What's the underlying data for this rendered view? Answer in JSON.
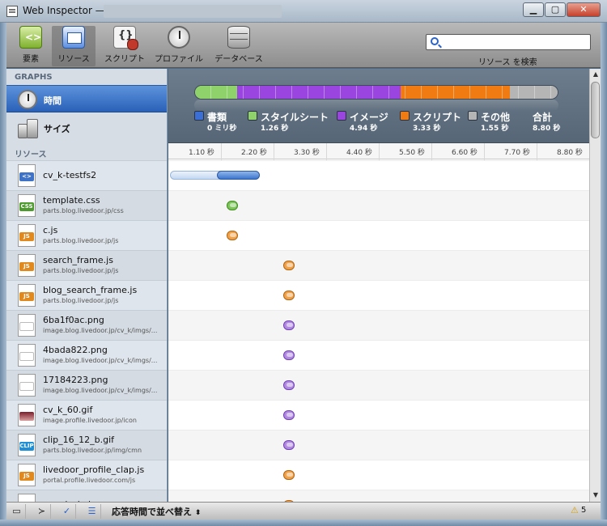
{
  "window": {
    "title": "Web Inspector —"
  },
  "toolbar": {
    "elements_label": "要素",
    "resources_label": "リソース",
    "scripts_label": "スクリプト",
    "profiles_label": "プロファイル",
    "databases_label": "データベース",
    "search_placeholder": "",
    "search_label": "リソース を検索"
  },
  "sidebar": {
    "graphs_title": "GRAPHS",
    "graphs": [
      {
        "label": "時間",
        "icon": "clock-icon",
        "selected": true
      },
      {
        "label": "サイズ",
        "icon": "weights-icon",
        "selected": false
      }
    ],
    "resources_title": "リソース",
    "resources": [
      {
        "name": "cv_k-testfs2",
        "url": "",
        "kind": "html"
      },
      {
        "name": "template.css",
        "url": "parts.blog.livedoor.jp/css",
        "kind": "css"
      },
      {
        "name": "c.js",
        "url": "parts.blog.livedoor.jp/js",
        "kind": "js"
      },
      {
        "name": "search_frame.js",
        "url": "parts.blog.livedoor.jp/js",
        "kind": "js"
      },
      {
        "name": "blog_search_frame.js",
        "url": "parts.blog.livedoor.jp/js",
        "kind": "js"
      },
      {
        "name": "6ba1f0ac.png",
        "url": "image.blog.livedoor.jp/cv_k/imgs/...",
        "kind": "img"
      },
      {
        "name": "4bada822.png",
        "url": "image.blog.livedoor.jp/cv_k/imgs/...",
        "kind": "img"
      },
      {
        "name": "17184223.png",
        "url": "image.blog.livedoor.jp/cv_k/imgs/...",
        "kind": "img"
      },
      {
        "name": "cv_k_60.gif",
        "url": "image.profile.livedoor.jp/icon",
        "kind": "gif-avatar"
      },
      {
        "name": "clip_16_12_b.gif",
        "url": "parts.blog.livedoor.jp/img/cmn",
        "kind": "clip"
      },
      {
        "name": "livedoor_profile_clap.js",
        "url": "portal.profile.livedoor.com/js",
        "kind": "js"
      },
      {
        "name": "google_ja.js",
        "url": "",
        "kind": "js"
      }
    ]
  },
  "summary": {
    "legend": [
      {
        "label": "書類",
        "value": "0 ミリ秒",
        "color": "#3b6fd6"
      },
      {
        "label": "スタイルシート",
        "value": "1.26 秒",
        "color": "#8fd16a"
      },
      {
        "label": "イメージ",
        "value": "4.94 秒",
        "color": "#9b45e0"
      },
      {
        "label": "スクリプト",
        "value": "3.33 秒",
        "color": "#f07b12"
      },
      {
        "label": "その他",
        "value": "1.55 秒",
        "color": "#b5b5b5"
      }
    ],
    "total_label": "合計",
    "total_value": "8.80 秒",
    "bar_fractions": [
      0.0,
      0.115,
      0.45,
      0.3,
      0.135
    ]
  },
  "timeline": {
    "ticks": [
      "1.10 秒",
      "2.20 秒",
      "3.30 秒",
      "4.40 秒",
      "5.50 秒",
      "6.60 秒",
      "7.70 秒",
      "8.80 秒"
    ],
    "max_seconds": 8.8,
    "rows": [
      {
        "type": "bar",
        "start": 0.0,
        "latency_end": 0.98,
        "end": 1.88
      },
      {
        "type": "dot",
        "kind": "css",
        "at": 1.3
      },
      {
        "type": "dot",
        "kind": "js",
        "at": 1.3
      },
      {
        "type": "dot",
        "kind": "js",
        "at": 2.5
      },
      {
        "type": "dot",
        "kind": "js",
        "at": 2.5
      },
      {
        "type": "dot",
        "kind": "img",
        "at": 2.5
      },
      {
        "type": "dot",
        "kind": "img",
        "at": 2.5
      },
      {
        "type": "dot",
        "kind": "img",
        "at": 2.5
      },
      {
        "type": "dot",
        "kind": "img",
        "at": 2.5
      },
      {
        "type": "dot",
        "kind": "img",
        "at": 2.5
      },
      {
        "type": "dot",
        "kind": "js",
        "at": 2.5
      },
      {
        "type": "dot",
        "kind": "js",
        "at": 2.5
      }
    ]
  },
  "statusbar": {
    "sort_label": "応答時間で並べ替え",
    "sort_arrows": "⬍",
    "warning_icon": "⚠",
    "warning_count": "5"
  }
}
